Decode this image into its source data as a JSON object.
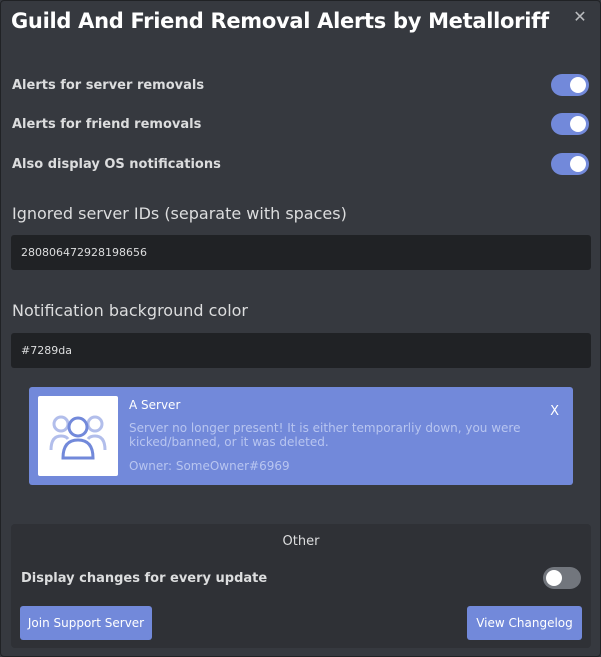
{
  "title": "Guild And Friend Removal Alerts by Metalloriff",
  "close_glyph": "✕",
  "toggles": [
    {
      "label": "Alerts for server removals",
      "on": true
    },
    {
      "label": "Alerts for friend removals",
      "on": true
    },
    {
      "label": "Also display OS notifications",
      "on": true
    }
  ],
  "ignored": {
    "label": "Ignored server IDs (separate with spaces)",
    "value": "280806472928198656"
  },
  "bgcolor": {
    "label": "Notification background color",
    "value": "#7289da"
  },
  "notification": {
    "server_name": "A Server",
    "message": "Server no longer present! It is either temporarliy down, you were kicked/banned, or it was deleted.",
    "owner": "Owner: SomeOwner#6969",
    "close_label": "X",
    "icon": "group-icon",
    "color": "#7289da"
  },
  "other": {
    "title": "Other",
    "toggle_label": "Display changes for every update",
    "toggle_on": false,
    "support_button": "Join Support Server",
    "changelog_button": "View Changelog"
  },
  "colors": {
    "accent": "#7289da",
    "background": "#36393f",
    "input": "#202225",
    "panel": "#2f3136"
  }
}
